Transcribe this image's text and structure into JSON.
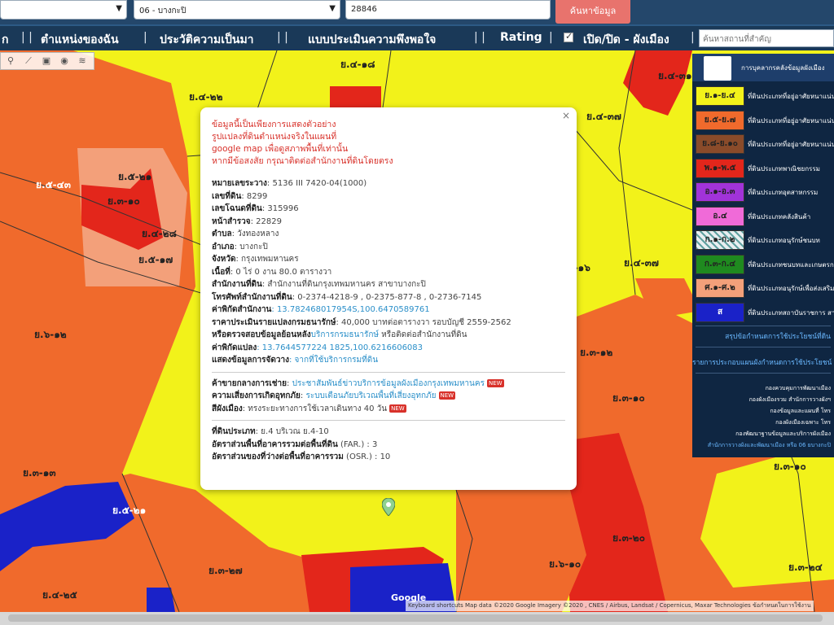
{
  "top": {
    "select1_value": "",
    "select2_value": "06 - บางกะปิ",
    "input_value": "28846",
    "search_button": "ค้นหาข้อมูล"
  },
  "menu": {
    "item0": "ก",
    "item1": "ตำแหน่งของฉัน",
    "item2": "ประวัติความเป็นมา",
    "item3": "แบบประเมินความพึงพอใจ",
    "item4": "Rating",
    "item5": "เปิด/ปิด - ผังเมือง",
    "place_search_placeholder": "ค้นหาสถานที่สำคัญ",
    "separator": "|",
    "separator_double": "| |"
  },
  "colors": {
    "yellow_zone": "#f2f21a",
    "orange_zone": "#f06a2c",
    "red_zone": "#e3261b",
    "blue_zone": "#1a22c8",
    "brown_zone": "#8a4b2a",
    "purple_zone": "#a133d9",
    "pink_zone": "#f06ad8",
    "green_zone": "#1f8a1f",
    "salmon_zone": "#f3a07a"
  },
  "map_labels": [
    "ย.๔-๑๘",
    "ย.๔-๒๒",
    "ย.๔-๓๗",
    "ย.๔-๓๗",
    "ย.๔-๓๑",
    "ย.๕-๒๑",
    "ย.๕-๔๓",
    "ย.๓-๑๐",
    "ย.๔-๒๘",
    "ย.๕-๑๗",
    "ย.๔-๑๖",
    "ย.๖-๑๒",
    "ย.๓-๑๒",
    "ย.๓-๑๐",
    "ย.๓-๑๓",
    "ย.๓-๑๐",
    "ย.๕-๒๑",
    "ย.๓-๒๐",
    "ย.๓-๒๗",
    "ย.๖-๑๐",
    "ย.๔-๒๕",
    "ย.๓-๒๔",
    "ย.๓-๒๔",
    "ย.๓-๑๐",
    "ย.๔-๒๕",
    "ย.๓-๑๕"
  ],
  "popup": {
    "close": "×",
    "warn1": "ข้อมูลนี้เป็นเพียงการแสดงตัวอย่าง",
    "warn2": "รูปแปลงที่ดินตำแหน่งจริงในแผนที่",
    "warn3": "google map เพื่อดูสภาพพื้นที่เท่านั้น",
    "warn4": "หากมีข้อสงสัย กรุณาติดต่อสำนักงานที่ดินโดยตรง",
    "rows": [
      {
        "k": "หมายเลขระวาง",
        "v": ": 5136 III 7420-04(1000)"
      },
      {
        "k": "เลขที่ดิน",
        "v": ": 8299"
      },
      {
        "k": "เลขโฉนดที่ดิน",
        "v": ": 315996"
      },
      {
        "k": "หน้าสำรวจ",
        "v": ": 22829"
      },
      {
        "k": "ตำบล",
        "v": ": วังทองหลาง"
      },
      {
        "k": "อำเภอ",
        "v": ": บางกะปิ"
      },
      {
        "k": "จังหวัด",
        "v": ": กรุงเทพมหานคร"
      },
      {
        "k": "เนื้อที่",
        "v": ": 0 ไร่ 0 งาน 80.0 ตารางวา"
      },
      {
        "k": "สำนักงานที่ดิน",
        "v": ": สำนักงานที่ดินกรุงเทพมหานคร สาขาบางกะปิ"
      },
      {
        "k": "โทรศัพท์สำนักงานที่ดิน",
        "v": ": 0-2374-4218-9 , 0-2375-877-8 , 0-2736-7145"
      },
      {
        "k": "ค่าพิกัดสำนักงาน",
        "v": "",
        "lnk": ": 13.782468017954S,100.6470589761"
      },
      {
        "k": "ราคาประเมินรายแปลงกรมธนารักษ์",
        "v": ": 40,000 บาทต่อตารางวา รอบบัญชี 2559-2562"
      },
      {
        "k": "หรือตรวจสอบข้อมูลย้อนหลัง",
        "v": "",
        "lnk": "บริการกรมธนารักษ์",
        "v2": " หรือติดต่อสำนักงานที่ดิน"
      },
      {
        "k": "ค่าพิกัดแปลง",
        "v": "",
        "lnk": ": 13.7644577224 1825,100.6216606083"
      },
      {
        "k": "แสดงข้อมูลการจัดวาง",
        "v": "",
        "lnk": ": จากที่ใช้บริการกรมที่ดิน"
      }
    ],
    "rows2": [
      {
        "k": "ค้าขายกลางการเช่าย",
        "v": ": ",
        "lnk": "ประชาสัมพันธ์ข่าวบริการข้อมูลผังเมืองกรุงเทพมหานคร",
        "tag": "NEW"
      },
      {
        "k": "ความเสี่ยงการเกิดอุทกภัย",
        "v": ": ",
        "lnk": "ระบบเตือนภัยบริเวณพื้นที่เสี่ยงอุทกภัย",
        "tag": "NEW"
      },
      {
        "k": "สีผังเมือง",
        "v": ": ทรงระยะทางการใช้เวลาเดินทาง 40 วัน",
        "lnk": "",
        "tag": "NEW"
      }
    ],
    "rows3": [
      {
        "k": "ที่ดินประเภท",
        "v": ": ย.4 บริเวณ  ย.4-10"
      },
      {
        "k": "อัตราส่วนพื้นที่อาคารรวมต่อพื้นที่ดิน",
        "v": " (FAR.) : 3"
      },
      {
        "k": "อัตราส่วนของที่ว่างต่อพื้นที่อาคารรวม",
        "v": " (OSR.) : 10"
      }
    ]
  },
  "legend": {
    "title": "การบุคลากรคลังข้อมูลผังเมือง",
    "items": [
      {
        "code": "ย.๑-ย.๔",
        "color": "#f2f21a",
        "text_color": "#222",
        "label": "ที่ดินประเภทที่อยู่อาศัยหนาแน่นน้อย"
      },
      {
        "code": "ย.๕-ย.๗",
        "color": "#f06a2c",
        "text_color": "#222",
        "label": "ที่ดินประเภทที่อยู่อาศัยหนาแน่นปานกลาง"
      },
      {
        "code": "ย.๘-ย.๑๐",
        "color": "#8a4b2a",
        "text_color": "#222",
        "label": "ที่ดินประเภทที่อยู่อาศัยหนาแน่นมาก"
      },
      {
        "code": "พ.๑-พ.๕",
        "color": "#e3261b",
        "text_color": "#222",
        "label": "ที่ดินประเภทพาณิชยกรรม"
      },
      {
        "code": "อ.๑-อ.๓",
        "color": "#a133d9",
        "text_color": "#222",
        "label": "ที่ดินประเภทอุตสาหกรรม"
      },
      {
        "code": "อ.๔",
        "color": "#f06ad8",
        "text_color": "#222",
        "label": "ที่ดินประเภทคลังสินค้า"
      },
      {
        "code": "ก.๑-ก.๒",
        "color": "#e8eef0",
        "text_color": "#222",
        "label": "ที่ดินประเภทอนุรักษ์ชนบท"
      },
      {
        "code": "ก.๓-ก.๔",
        "color": "#1f8a1f",
        "text_color": "#222",
        "label": "ที่ดินประเภทชนบทและเกษตรกรรม"
      },
      {
        "code": "ศ.๑-ศ.๒",
        "color": "#f3a07a",
        "text_color": "#222",
        "label": "ที่ดินประเภทอนุรักษ์เพื่อส่งเสริมเอกลักษณ์ศิลปวัฒนธรรม"
      },
      {
        "code": "ส",
        "color": "#1a22c8",
        "text_color": "#fff",
        "label": "ที่ดินประเภทสถาบันราชการ สาธารณูปการ"
      }
    ],
    "link1": "สรุปข้อกำหนดการใช้ประโยชน์ที่ดิน",
    "link2": "รายการประกอบแผนผังกำหนดการใช้ประโยชน์",
    "small1": "กองควบคุมการพัฒนาเมือง",
    "small2": "กองผังเมืองรวม สำนักการวางผังฯ",
    "small3": "กองข้อมูลและแผนที่ โทร",
    "small4": "กองผังเมืองเฉพาะ โทร",
    "small5": "กองพัฒนาฐานข้อมูลและบริการผังเมือง",
    "small6": "สำนักการวางผังและพัฒนาเมือง หรือ 06 ยบางกะปิ"
  },
  "attribution": "Keyboard shortcuts  Map data ©2020 Google Imagery ©2020 , CNES / Airbus, Landsat / Copernicus, Maxar Technologies    ข้อกำหนดในการใช้งาน",
  "google_logo": "Google"
}
